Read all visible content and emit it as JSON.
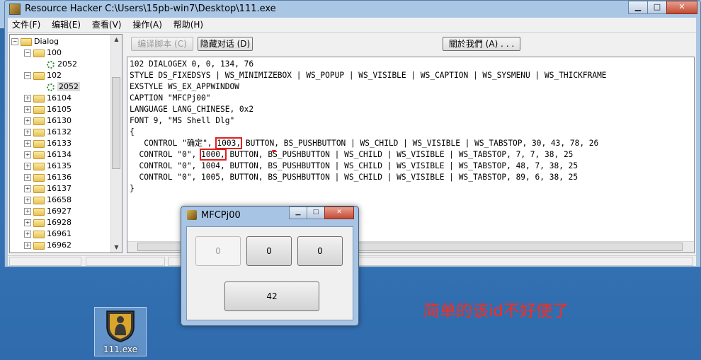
{
  "main_window": {
    "title": "Resource Hacker    C:\\Users\\15pb-win7\\Desktop\\111.exe",
    "controls": {
      "minimize": "▁",
      "maximize": "□",
      "close": "✕"
    }
  },
  "menu": [
    "文件(F)",
    "编辑(E)",
    "查看(V)",
    "操作(A)",
    "帮助(H)"
  ],
  "toolbar": {
    "compile": "编译脚本 (C)",
    "hide_dialog": "隐藏对话 (D)",
    "about": "關於我們 (A) . . ."
  },
  "tree": {
    "root": "Dialog",
    "nodes": [
      {
        "label": "100",
        "child": "2052"
      },
      {
        "label": "102",
        "child": "2052"
      }
    ],
    "folders": [
      "16104",
      "16105",
      "16130",
      "16132",
      "16133",
      "16134",
      "16135",
      "16136",
      "16137",
      "16658",
      "16927",
      "16928",
      "16961",
      "16962"
    ]
  },
  "code": {
    "line1": "102 DIALOGEX 0, 0, 134, 76",
    "line2": "STYLE DS_FIXEDSYS | WS_MINIMIZEBOX | WS_POPUP | WS_VISIBLE | WS_CAPTION | WS_SYSMENU | WS_THICKFRAME",
    "line3": "EXSTYLE WS_EX_APPWINDOW",
    "line4": "CAPTION \"MFCPj00\"",
    "line5": "LANGUAGE LANG_CHINESE, 0x2",
    "line6": "FONT 9, \"MS Shell Dlg\"",
    "line7": "{",
    "c1_pre": "   CONTROL \"确定\", ",
    "c1_id": "1003,",
    "c1_post": " BUTTON, BS_PUSHBUTTON | WS_CHILD | WS_VISIBLE | WS_TABSTOP, 30, 43, 78, 26",
    "c2_pre": "  CONTROL \"0\", ",
    "c2_id": "1000,",
    "c2_post": " BUTTON, BS_PUSHBUTTON | WS_CHILD | WS_VISIBLE | WS_TABSTOP, 7, 7, 38, 25",
    "c3": "  CONTROL \"0\", 1004, BUTTON, BS_PUSHBUTTON | WS_CHILD | WS_VISIBLE | WS_TABSTOP, 48, 7, 38, 25",
    "c4": "  CONTROL \"0\", 1005, BUTTON, BS_PUSHBUTTON | WS_CHILD | WS_VISIBLE | WS_TABSTOP, 89, 6, 38, 25",
    "line_end": "}"
  },
  "dialog": {
    "title": "MFCPj00",
    "btn1": "0",
    "btn2": "0",
    "btn3": "0",
    "btn_main": "42"
  },
  "desktop": {
    "icon_label": "111.exe"
  },
  "annotation": "简单的该id不好使了",
  "colors": {
    "highlight": "#e02020",
    "annotation": "#ff2a1a"
  }
}
